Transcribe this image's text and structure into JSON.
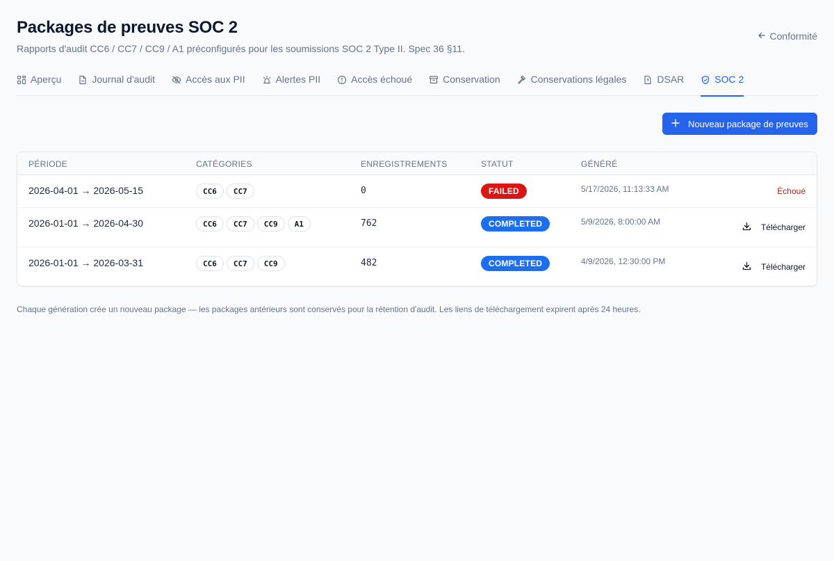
{
  "header": {
    "title": "Packages de preuves SOC 2",
    "subtitle": "Rapports d'audit CC6 / CC7 / CC9 / A1 préconfigurés pour les soumissions SOC 2 Type II. Spec 36 §11.",
    "back_label": "Conformité"
  },
  "tabs": [
    {
      "label": "Aperçu",
      "icon": "grid-icon"
    },
    {
      "label": "Journal d'audit",
      "icon": "file-icon"
    },
    {
      "label": "Accès aux PII",
      "icon": "eye-off-icon"
    },
    {
      "label": "Alertes PII",
      "icon": "siren-icon"
    },
    {
      "label": "Accès échoué",
      "icon": "alert-circle-icon"
    },
    {
      "label": "Conservation",
      "icon": "archive-icon"
    },
    {
      "label": "Conservations légales",
      "icon": "gavel-icon"
    },
    {
      "label": "DSAR",
      "icon": "document-icon"
    },
    {
      "label": "SOC 2",
      "icon": "shield-check-icon",
      "active": true
    }
  ],
  "actions": {
    "new_package_label": "Nouveau package de preuves"
  },
  "table": {
    "headers": {
      "period": "PÉRIODE",
      "categories": "CATÉGORIES",
      "records": "ENREGISTREMENTS",
      "status": "STATUT",
      "generated": "GÉNÉRÉ"
    },
    "rows": [
      {
        "period": "2026-04-01 → 2026-05-15",
        "categories": [
          "CC6",
          "CC7"
        ],
        "records": "0",
        "status": "FAILED",
        "generated": "5/17/2026, 11:13:33 AM",
        "action": "Échoué"
      },
      {
        "period": "2026-01-01 → 2026-04-30",
        "categories": [
          "CC6",
          "CC7",
          "CC9",
          "A1"
        ],
        "records": "762",
        "status": "COMPLETED",
        "generated": "5/9/2026, 8:00:00 AM",
        "action": "Télécharger"
      },
      {
        "period": "2026-01-01 → 2026-03-31",
        "categories": [
          "CC6",
          "CC7",
          "CC9"
        ],
        "records": "482",
        "status": "COMPLETED",
        "generated": "4/9/2026, 12:30:00 PM",
        "action": "Télécharger"
      }
    ]
  },
  "footnote": "Chaque génération crée un nouveau package — les packages antérieurs sont conservés pour la rétention d'audit. Les liens de téléchargement expirent après 24 heures.",
  "colors": {
    "accent": "#2563eb",
    "failed": "#dc1414",
    "completed": "#1d6ff2"
  }
}
